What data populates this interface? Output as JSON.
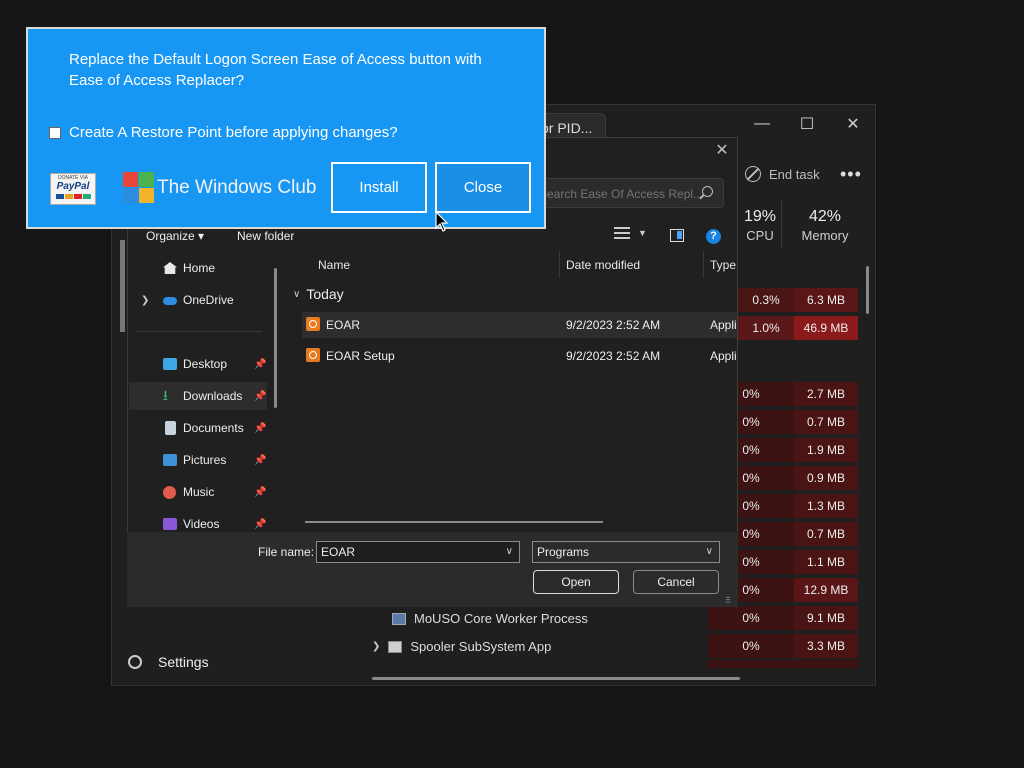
{
  "taskmanager": {
    "tab_label": "or PID...",
    "end_task_label": "End task",
    "more_label": "•••",
    "cpu": {
      "pct": "19%",
      "label": "CPU"
    },
    "memory": {
      "pct": "42%",
      "label": "Memory"
    },
    "settings_label": "Settings",
    "rows": [
      {
        "cpu": "0.3%",
        "mem": "6.3 MB"
      },
      {
        "cpu": "1.0%",
        "mem": "46.9 MB"
      },
      {
        "cpu": "0%",
        "mem": "2.7 MB"
      },
      {
        "cpu": "0%",
        "mem": "0.7 MB"
      },
      {
        "cpu": "0%",
        "mem": "1.9 MB"
      },
      {
        "cpu": "0%",
        "mem": "0.9 MB"
      },
      {
        "cpu": "0%",
        "mem": "1.3 MB"
      },
      {
        "cpu": "0%",
        "mem": "0.7 MB"
      },
      {
        "cpu": "0%",
        "mem": "1.1 MB"
      },
      {
        "cpu": "0%",
        "mem": "12.9 MB"
      },
      {
        "cpu": "0%",
        "mem": "9.1 MB"
      },
      {
        "cpu": "0%",
        "mem": "3.3 MB"
      }
    ],
    "processes": [
      {
        "name": "MoUSO Core Worker Process"
      },
      {
        "name": "Spooler SubSystem App"
      }
    ]
  },
  "dialog": {
    "search_placeholder": "Search Ease Of Access Repl...",
    "toolbar": {
      "organize": "Organize ▾",
      "new_folder": "New folder"
    },
    "nav": [
      {
        "label": "Home",
        "color": "#e8e8e8"
      },
      {
        "label": "OneDrive",
        "color": "#2f8bdf"
      },
      {
        "label": "Desktop",
        "color": "#3fa5e9"
      },
      {
        "label": "Downloads",
        "color": "#2fbf71"
      },
      {
        "label": "Documents",
        "color": "#c9d3df"
      },
      {
        "label": "Pictures",
        "color": "#3f8fd9"
      },
      {
        "label": "Music",
        "color": "#e05c4a"
      },
      {
        "label": "Videos",
        "color": "#8a58d6"
      }
    ],
    "columns": {
      "name": "Name",
      "date": "Date modified",
      "type": "Type"
    },
    "group": "Today",
    "files": [
      {
        "name": "EOAR",
        "date": "9/2/2023 2:52 AM",
        "type": "Appli"
      },
      {
        "name": "EOAR Setup",
        "date": "9/2/2023 2:52 AM",
        "type": "Appli"
      }
    ],
    "filename_label": "File name:",
    "filename_value": "EOAR",
    "filetype_value": "Programs",
    "open_label": "Open",
    "cancel_label": "Cancel",
    "help_glyph": "?"
  },
  "popup": {
    "message": "Replace the Default Logon Screen Ease of Access button with Ease of Access Replacer?",
    "checkbox_label": "Create A Restore Point before applying changes?",
    "paypal": {
      "top": "DONATE VIA",
      "brand": "PayPal"
    },
    "brand_name": "The Windows Club",
    "install_label": "Install",
    "close_label": "Close"
  },
  "colors": {
    "popup_bg": "#1797f3",
    "cpu_heat": "#3c1212",
    "mem_heat_high": "#8b1a1a"
  }
}
